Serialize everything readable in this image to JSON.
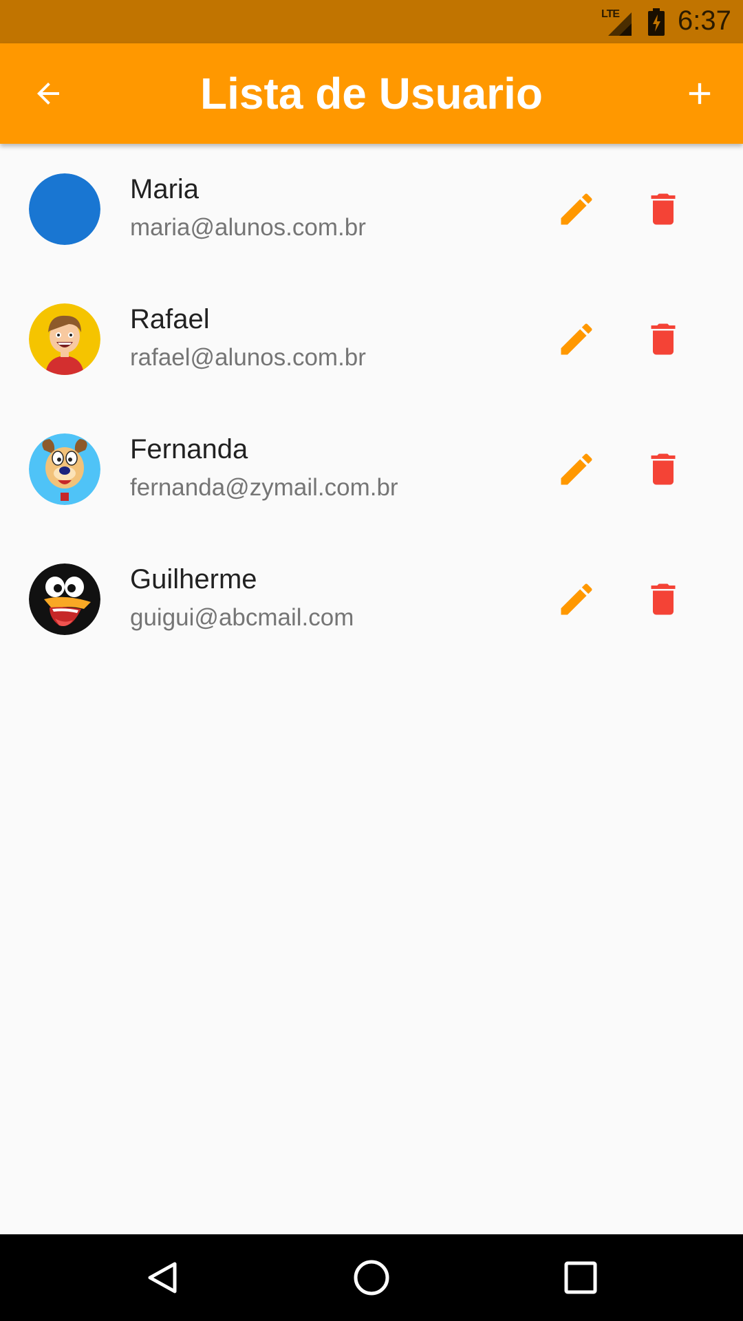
{
  "status_bar": {
    "network_label": "LTE",
    "time": "6:37",
    "icons": [
      "lte-signal-icon",
      "battery-charging-icon"
    ]
  },
  "app_bar": {
    "title": "Lista de Usuario",
    "back_icon": "arrow-back-icon",
    "add_icon": "add-icon",
    "background_color": "#ff9800"
  },
  "users": [
    {
      "name": "Maria",
      "email": "maria@alunos.com.br",
      "avatar": "blue-circle-avatar"
    },
    {
      "name": "Rafael",
      "email": "rafael@alunos.com.br",
      "avatar": "cartoon-boy-avatar"
    },
    {
      "name": "Fernanda",
      "email": "fernanda@zymail.com.br",
      "avatar": "cartoon-dog-avatar"
    },
    {
      "name": "Guilherme",
      "email": "guigui@abcmail.com",
      "avatar": "cartoon-penguin-avatar"
    }
  ],
  "row_actions": {
    "edit_icon": "pencil-icon",
    "delete_icon": "trash-icon",
    "edit_color": "#ff9800",
    "delete_color": "#f44336"
  },
  "nav_bar": {
    "icons": [
      "back-triangle-icon",
      "home-circle-icon",
      "recents-square-icon"
    ]
  }
}
